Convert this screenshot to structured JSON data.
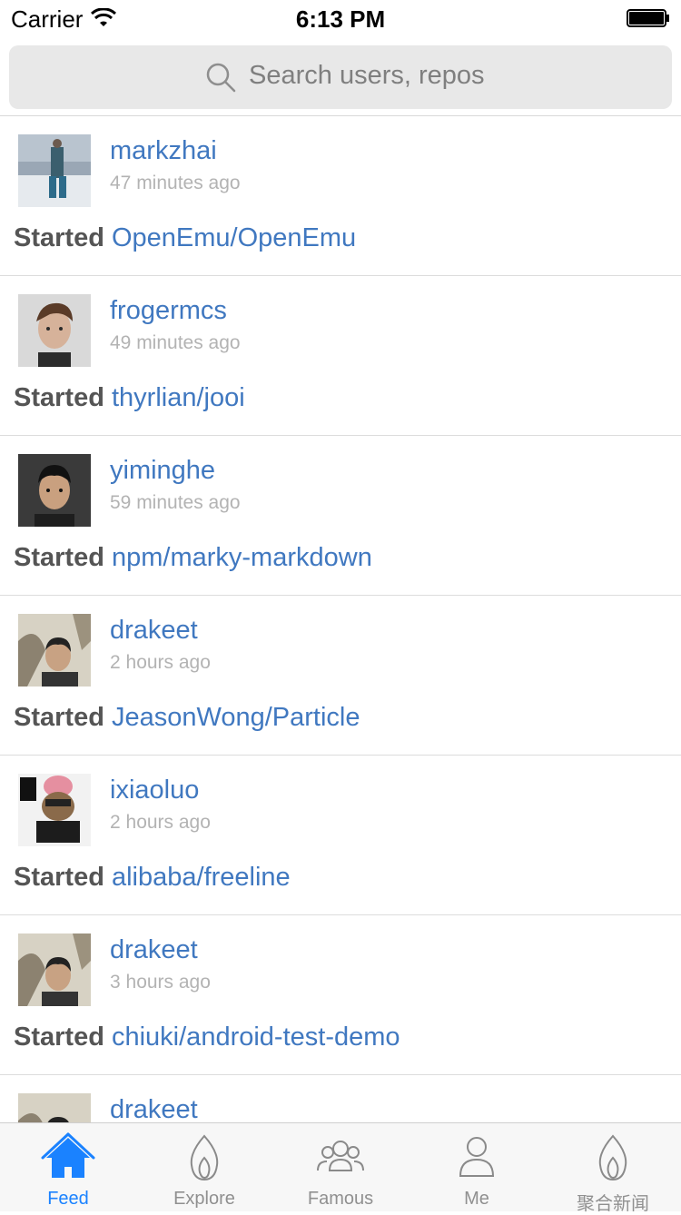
{
  "status_bar": {
    "carrier": "Carrier",
    "time": "6:13 PM"
  },
  "search": {
    "placeholder": "Search users, repos"
  },
  "feed": [
    {
      "user": "markzhai",
      "time": "47 minutes ago",
      "action": "Started",
      "repo": "OpenEmu/OpenEmu"
    },
    {
      "user": "frogermcs",
      "time": "49 minutes ago",
      "action": "Started",
      "repo": "thyrlian/jooi"
    },
    {
      "user": "yiminghe",
      "time": "59 minutes ago",
      "action": "Started",
      "repo": "npm/marky-markdown"
    },
    {
      "user": "drakeet",
      "time": "2 hours ago",
      "action": "Started",
      "repo": "JeasonWong/Particle"
    },
    {
      "user": "ixiaoluo",
      "time": "2 hours ago",
      "action": "Started",
      "repo": "alibaba/freeline"
    },
    {
      "user": "drakeet",
      "time": "3 hours ago",
      "action": "Started",
      "repo": "chiuki/android-test-demo"
    },
    {
      "user": "drakeet",
      "time": "",
      "action": "",
      "repo": ""
    }
  ],
  "tab_bar": {
    "tabs": [
      {
        "label": "Feed",
        "icon": "home-icon",
        "active": true
      },
      {
        "label": "Explore",
        "icon": "flame-icon",
        "active": false
      },
      {
        "label": "Famous",
        "icon": "people-icon",
        "active": false
      },
      {
        "label": "Me",
        "icon": "person-icon",
        "active": false
      },
      {
        "label": "聚合新闻",
        "icon": "flame-icon",
        "active": false
      }
    ]
  },
  "colors": {
    "link": "#4078c0",
    "accent": "#1a82ff",
    "muted": "#b3b3b3"
  }
}
